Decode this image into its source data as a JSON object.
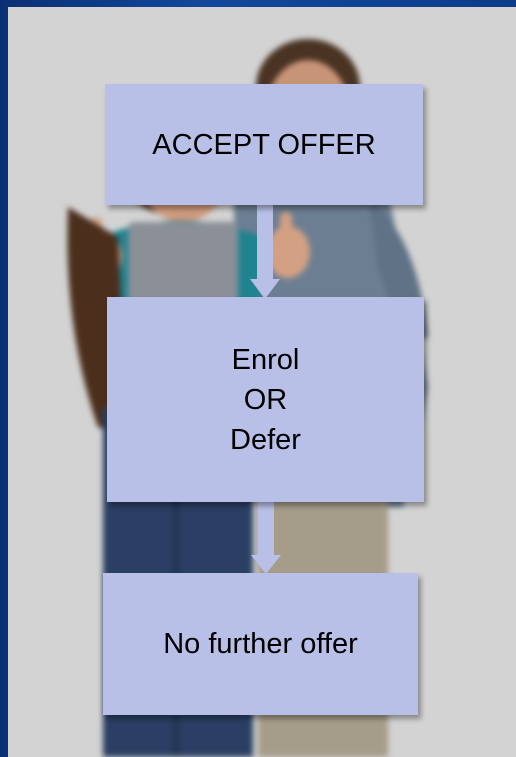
{
  "flowchart": {
    "steps": [
      {
        "label": "ACCEPT OFFER"
      },
      {
        "lines": [
          "Enrol",
          "OR",
          "Defer"
        ]
      },
      {
        "label": "No further offer"
      }
    ]
  },
  "colors": {
    "box_fill": "#b8c0e8",
    "arrow_fill": "#b8c0e8",
    "border_blue": "#0f3a86",
    "background_gray": "#d3d3d3"
  }
}
